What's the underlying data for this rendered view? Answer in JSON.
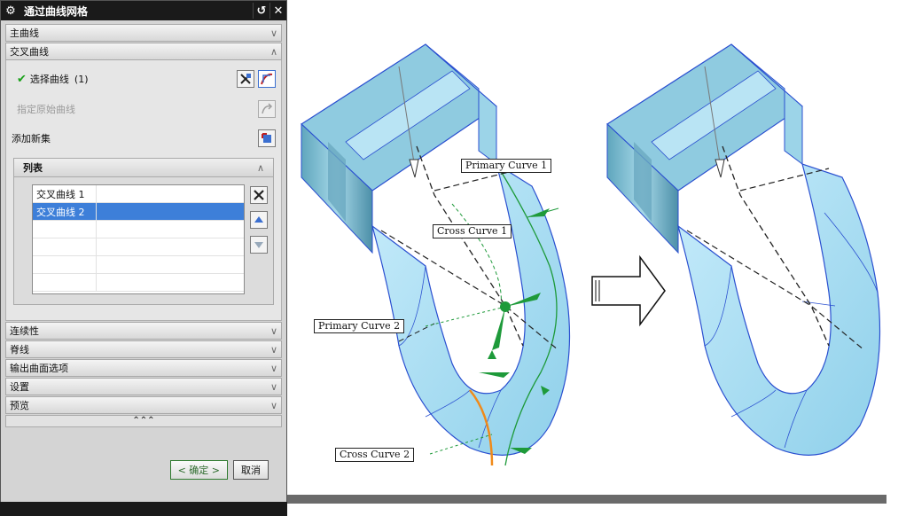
{
  "dialog": {
    "title": "通过曲线网格",
    "reset_icon": "reset-icon",
    "close_icon": "close-icon",
    "sections": {
      "primary_curves": "主曲线",
      "cross_curves": "交叉曲线",
      "continuity": "连续性",
      "spine": "脊线",
      "output_options": "输出曲面选项",
      "settings": "设置",
      "preview": "预览"
    },
    "cross_panel": {
      "select_curve_label": "选择曲线",
      "select_curve_count": "(1)",
      "specify_origin_label": "指定原始曲线",
      "add_new_label": "添加新集",
      "list_title": "列表",
      "list_items": [
        "交叉曲线 1",
        "交叉曲线 2"
      ],
      "selected_index": 1
    },
    "more_indicator": "⌃⌃⌃",
    "ok_label": "< 确定 >",
    "cancel_label": "取消"
  },
  "viewport": {
    "labels": {
      "primary_curve_1": "Primary Curve  1",
      "cross_curve_1": "Cross Curve  1",
      "primary_curve_2": "Primary Curve  2",
      "cross_curve_2": "Cross Curve  2"
    },
    "arrow_icon": "right-arrow-icon",
    "colors": {
      "surface": "#a9dcf2",
      "surface_dark": "#6fb9d6",
      "edge": "#2a4fd0",
      "green": "#1e9a3a",
      "orange": "#f08a1a"
    }
  }
}
